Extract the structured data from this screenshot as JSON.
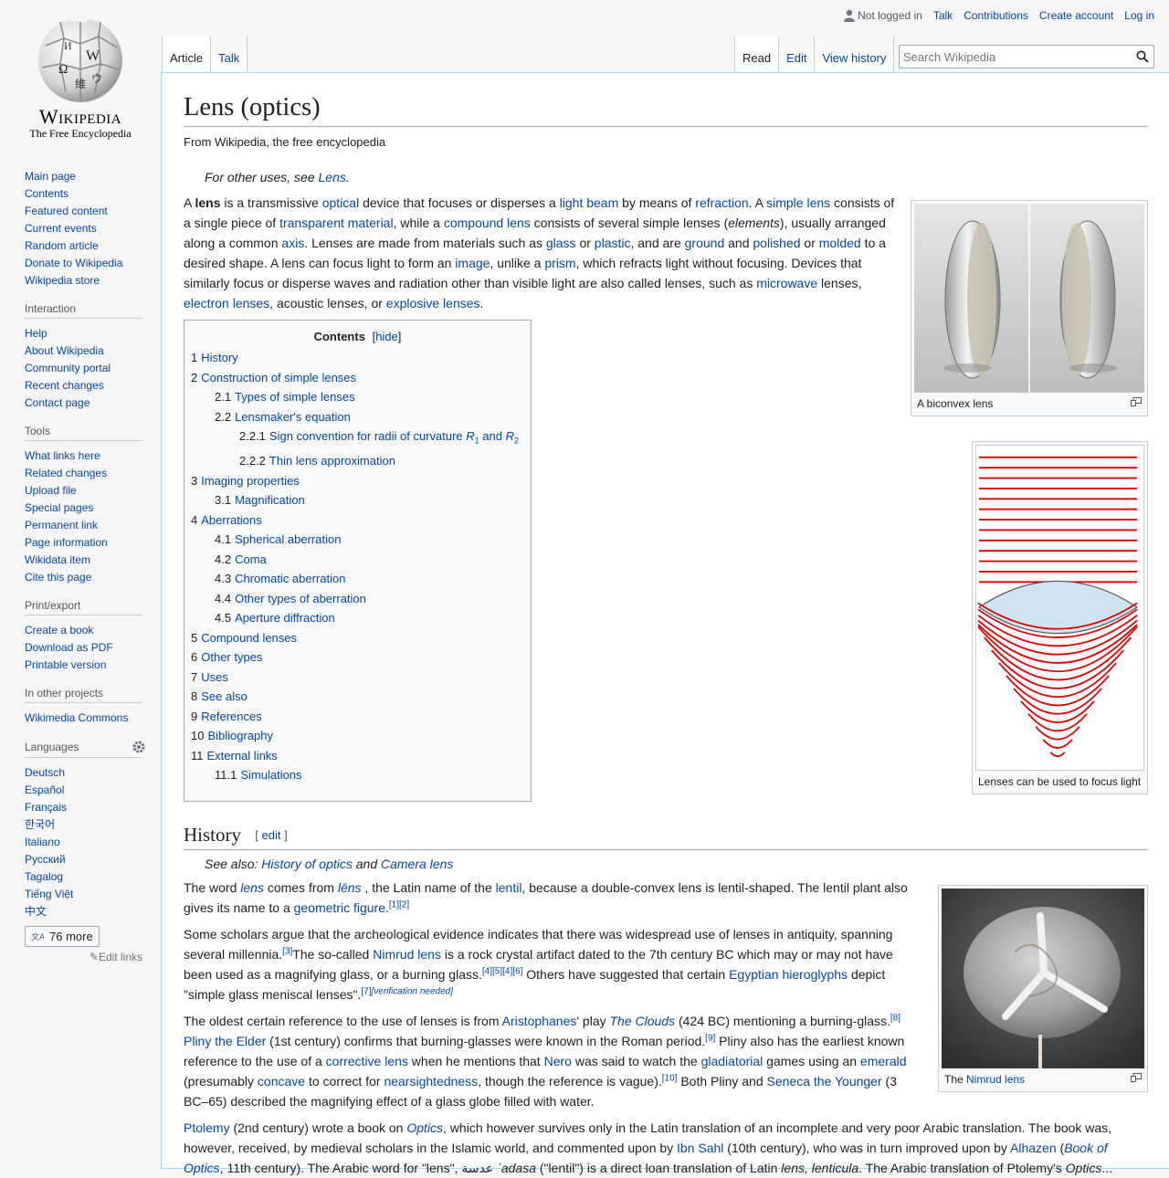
{
  "logo": {
    "wordmark": "Wikipedia",
    "tagline": "The Free Encyclopedia"
  },
  "personal": {
    "not_logged_in": "Not logged in",
    "talk": "Talk",
    "contributions": "Contributions",
    "create_account": "Create account",
    "login": "Log in"
  },
  "nav": {
    "main": [
      "Main page",
      "Contents",
      "Featured content",
      "Current events",
      "Random article",
      "Donate to Wikipedia",
      "Wikipedia store"
    ],
    "interaction_title": "Interaction",
    "interaction": [
      "Help",
      "About Wikipedia",
      "Community portal",
      "Recent changes",
      "Contact page"
    ],
    "tools_title": "Tools",
    "tools": [
      "What links here",
      "Related changes",
      "Upload file",
      "Special pages",
      "Permanent link",
      "Page information",
      "Wikidata item",
      "Cite this page"
    ],
    "print_title": "Print/export",
    "print": [
      "Create a book",
      "Download as PDF",
      "Printable version"
    ],
    "projects_title": "In other projects",
    "projects": [
      "Wikimedia Commons"
    ],
    "languages_title": "Languages",
    "languages": [
      "Deutsch",
      "Español",
      "Français",
      "한국어",
      "Italiano",
      "Русский",
      "Tagalog",
      "Tiếng Việt",
      "中文"
    ],
    "more_langs": "76 more",
    "edit_links": "Edit links"
  },
  "tabs": {
    "article": "Article",
    "talk": "Talk",
    "read": "Read",
    "edit": "Edit",
    "history": "View history"
  },
  "search": {
    "placeholder": "Search Wikipedia"
  },
  "article": {
    "title": "Lens (optics)",
    "tagline": "From Wikipedia, the free encyclopedia",
    "hatnote": {
      "pre": "For other uses, see ",
      "link": "Lens",
      "post": "."
    },
    "intro": [
      {
        "t": "A "
      },
      {
        "b": "lens"
      },
      {
        "t": " is a transmissive "
      },
      {
        "l": "optical"
      },
      {
        "t": " device that focuses or disperses a "
      },
      {
        "l": "light beam"
      },
      {
        "t": " by means of "
      },
      {
        "l": "refraction"
      },
      {
        "t": ". A "
      },
      {
        "l": "simple lens"
      },
      {
        "t": " consists of a single piece of "
      },
      {
        "l": "transparent material"
      },
      {
        "t": ", while a "
      },
      {
        "l": "compound lens"
      },
      {
        "t": " consists of several simple lenses ("
      },
      {
        "i": "elements"
      },
      {
        "t": "), usually arranged along a common "
      },
      {
        "l": "axis"
      },
      {
        "t": ". Lenses are made from materials such as "
      },
      {
        "l": "glass"
      },
      {
        "t": " or "
      },
      {
        "l": "plastic"
      },
      {
        "t": ", and are "
      },
      {
        "l": "ground"
      },
      {
        "t": " and "
      },
      {
        "l": "polished"
      },
      {
        "t": " or "
      },
      {
        "l": "molded"
      },
      {
        "t": " to a desired shape. A lens can focus light to form an "
      },
      {
        "l": "image"
      },
      {
        "t": ", unlike a "
      },
      {
        "l": "prism"
      },
      {
        "t": ", which refracts light without focusing. Devices that similarly focus or disperse waves and radiation other than visible light are also called lenses, such as "
      },
      {
        "l": "microwave"
      },
      {
        "t": " lenses, "
      },
      {
        "l": "electron lenses"
      },
      {
        "t": ", acoustic lenses, or "
      },
      {
        "l": "explosive lenses"
      },
      {
        "t": "."
      }
    ],
    "toc": {
      "title": "Contents",
      "hide": "hide",
      "items": [
        {
          "n": "1",
          "t": "History",
          "lvl": 1
        },
        {
          "n": "2",
          "t": "Construction of simple lenses",
          "lvl": 1
        },
        {
          "n": "2.1",
          "t": "Types of simple lenses",
          "lvl": 2
        },
        {
          "n": "2.2",
          "t": "Lensmaker's equation",
          "lvl": 2
        },
        {
          "n": "2.2.1",
          "t": "Sign convention for radii of curvature R1 and R2",
          "lvl": 3
        },
        {
          "n": "2.2.2",
          "t": "Thin lens approximation",
          "lvl": 3
        },
        {
          "n": "3",
          "t": "Imaging properties",
          "lvl": 1
        },
        {
          "n": "3.1",
          "t": "Magnification",
          "lvl": 2
        },
        {
          "n": "4",
          "t": "Aberrations",
          "lvl": 1
        },
        {
          "n": "4.1",
          "t": "Spherical aberration",
          "lvl": 2
        },
        {
          "n": "4.2",
          "t": "Coma",
          "lvl": 2
        },
        {
          "n": "4.3",
          "t": "Chromatic aberration",
          "lvl": 2
        },
        {
          "n": "4.4",
          "t": "Other types of aberration",
          "lvl": 2
        },
        {
          "n": "4.5",
          "t": "Aperture diffraction",
          "lvl": 2
        },
        {
          "n": "5",
          "t": "Compound lenses",
          "lvl": 1
        },
        {
          "n": "6",
          "t": "Other types",
          "lvl": 1
        },
        {
          "n": "7",
          "t": "Uses",
          "lvl": 1
        },
        {
          "n": "8",
          "t": "See also",
          "lvl": 1
        },
        {
          "n": "9",
          "t": "References",
          "lvl": 1
        },
        {
          "n": "10",
          "t": "Bibliography",
          "lvl": 1
        },
        {
          "n": "11",
          "t": "External links",
          "lvl": 1
        },
        {
          "n": "11.1",
          "t": "Simulations",
          "lvl": 2
        }
      ]
    },
    "history": {
      "heading": "History",
      "edit": "edit",
      "see_also": [
        {
          "t": "See also: "
        },
        {
          "l": "History of optics"
        },
        {
          "t": " and "
        },
        {
          "l": "Camera lens"
        }
      ],
      "p1": [
        {
          "t": "The word "
        },
        {
          "li": "lens"
        },
        {
          "t": " comes from "
        },
        {
          "li": "lēns"
        },
        {
          "t": " , the Latin name of the "
        },
        {
          "l": "lentil"
        },
        {
          "t": ", because a double-convex lens is lentil-shaped. The lentil plant also gives its name to a "
        },
        {
          "l": "geometric figure"
        },
        {
          "t": "."
        },
        {
          "s": "[1]"
        },
        {
          "s": "[2]"
        }
      ],
      "p2": [
        {
          "t": "Some scholars argue that the archeological evidence indicates that there was widespread use of lenses in antiquity, spanning several millennia."
        },
        {
          "s": "[3]"
        },
        {
          "t": "The so-called "
        },
        {
          "l": "Nimrud lens"
        },
        {
          "t": " is a rock crystal artifact dated to the 7th century BC which may or may not have been used as a magnifying glass, or a burning glass."
        },
        {
          "s": "[4]"
        },
        {
          "s": "[5]"
        },
        {
          "s": "[4]"
        },
        {
          "s": "[6]"
        },
        {
          "t": " Others have suggested that certain "
        },
        {
          "l": "Egyptian hieroglyphs"
        },
        {
          "t": " depict \"simple glass meniscal lenses\"."
        },
        {
          "s": "[7]"
        },
        {
          "sv": "[verification needed]"
        }
      ],
      "p3": [
        {
          "t": "The oldest certain reference to the use of lenses is from "
        },
        {
          "l": "Aristophanes"
        },
        {
          "t": "' play "
        },
        {
          "li": "The Clouds"
        },
        {
          "t": " (424 BC) mentioning a burning-glass."
        },
        {
          "s": "[8]"
        },
        {
          "t": " "
        },
        {
          "l": "Pliny the Elder"
        },
        {
          "t": " (1st century) confirms that burning-glasses were known in the Roman period."
        },
        {
          "s": "[9]"
        },
        {
          "t": " Pliny also has the earliest known reference to the use of a "
        },
        {
          "l": "corrective lens"
        },
        {
          "t": " when he mentions that "
        },
        {
          "l": "Nero"
        },
        {
          "t": " was said to watch the "
        },
        {
          "l": "gladiatorial"
        },
        {
          "t": " games using an "
        },
        {
          "l": "emerald"
        },
        {
          "t": " (presumably "
        },
        {
          "l": "concave"
        },
        {
          "t": " to correct for "
        },
        {
          "l": "nearsightedness"
        },
        {
          "t": ", though the reference is vague)."
        },
        {
          "s": "[10]"
        },
        {
          "t": " Both Pliny and "
        },
        {
          "l": "Seneca the Younger"
        },
        {
          "t": " (3 BC–65) described the magnifying effect of a glass globe filled with water."
        }
      ],
      "p4": [
        {
          "l": "Ptolemy"
        },
        {
          "t": " (2nd century) wrote a book on "
        },
        {
          "li": "Optics"
        },
        {
          "t": ", which however survives only in the Latin translation of an incomplete and very poor Arabic translation. The book was, however, received, by medieval scholars in the Islamic world, and commented upon by "
        },
        {
          "l": "Ibn Sahl"
        },
        {
          "t": " (10th century), who was in turn improved upon by "
        },
        {
          "l": "Alhazen"
        },
        {
          "t": " ("
        },
        {
          "li": "Book of Optics"
        },
        {
          "t": ", 11th century). The Arabic word for \"lens\", عدسة "
        },
        {
          "i": "ʿadasa"
        },
        {
          "t": " (\"lentil\") is a direct loan translation of Latin "
        },
        {
          "i": "lens, lenticula"
        },
        {
          "t": ". The Arabic translation of Ptolemy's "
        },
        {
          "i": "Optics"
        },
        {
          "t": "..."
        }
      ]
    },
    "figures": {
      "biconvex": "A biconvex lens",
      "focus": "Lenses can be used to focus light",
      "nimrud_pre": "The ",
      "nimrud_link": "Nimrud lens"
    }
  },
  "colors": {
    "link": "#0645ad",
    "wave": "#e00000",
    "lens_fill": "#cfe3f0"
  }
}
